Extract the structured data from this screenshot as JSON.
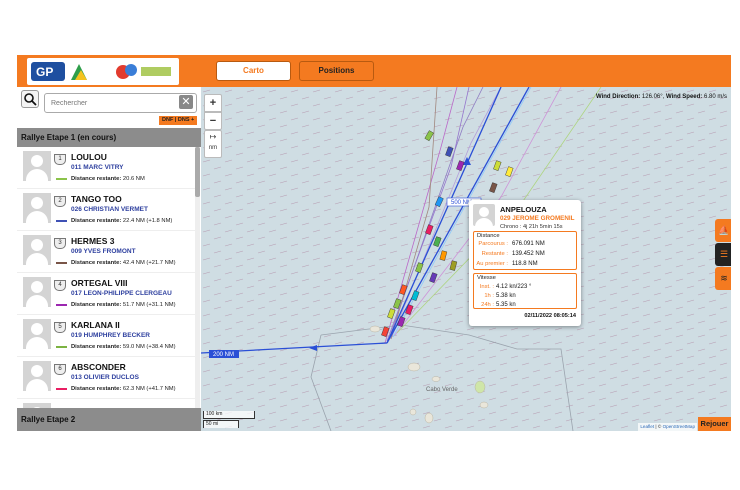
{
  "header": {
    "logo_text": "GP",
    "tabs": [
      {
        "label": "Carto"
      },
      {
        "label": "Positions"
      }
    ]
  },
  "sidebar": {
    "search_placeholder": "Rechercher",
    "clear_symbol": "✕",
    "filter_tag": "DNF | DNS +",
    "rally_current": "Rallye Etape 1 (en cours)",
    "rally_next": "Rallye Etape 2",
    "boats": [
      {
        "rank": "1",
        "name": "LOULOU",
        "skipper": "011 MARC VITRY",
        "distance_label": "Distance restante:",
        "distance_value": "20.6 NM",
        "color": "#8bc34a"
      },
      {
        "rank": "2",
        "name": "TANGO TOO",
        "skipper": "026 CHRISTIAN VERMET",
        "distance_label": "Distance restante:",
        "distance_value": "22.4 NM (+1.8 NM)",
        "color": "#3f51b5"
      },
      {
        "rank": "3",
        "name": "HERMES 3",
        "skipper": "009 YVES FROMONT",
        "distance_label": "Distance restante:",
        "distance_value": "42.4 NM (+21.7 NM)",
        "color": "#795548"
      },
      {
        "rank": "4",
        "name": "ORTEGAL VIII",
        "skipper": "017 LEON-PHILIPPE CLERGEAU",
        "distance_label": "Distance restante:",
        "distance_value": "51.7 NM (+31.1 NM)",
        "color": "#9c27b0"
      },
      {
        "rank": "5",
        "name": "KARLANA II",
        "skipper": "019 HUMPHREY BECKER",
        "distance_label": "Distance restante:",
        "distance_value": "59.0 NM (+38.4 NM)",
        "color": "#7cb342"
      },
      {
        "rank": "6",
        "name": "ABSCONDER",
        "skipper": "013 OLIVIER DUCLOS",
        "distance_label": "Distance restante:",
        "distance_value": "62.3 NM (+41.7 NM)",
        "color": "#e91e63"
      }
    ]
  },
  "map": {
    "wind_direction_label": "Wind Direction:",
    "wind_direction_value": "126.06°",
    "wind_speed_label": "Wind Speed:",
    "wind_speed_value": "6.80 m/s",
    "zoom_in": "+",
    "zoom_out": "−",
    "measure_unit": "nm",
    "line_label_top": "500 NM",
    "line_label_left": "200 NM",
    "island_label": "Cabo Verde",
    "scale_km": "100 km",
    "scale_mi": "50 mi",
    "attribution_leaflet": "Leaflet",
    "attribution_osm": "OpenStreetMap",
    "replay_button": "Rejouer"
  },
  "popup": {
    "boat_name": "ANPELOUZA",
    "skipper": "029 JEROME GROMENIL",
    "chrono": "Chrono : 4j 21h 5min 15s",
    "distance_title": "Distance",
    "parcourus_label": "Parcourus :",
    "parcourus_value": "676.091 NM",
    "restante_label": "Restante :",
    "restante_value": "139.452 NM",
    "premier_label": "Au premier :",
    "premier_value": "118.8 NM",
    "speed_title": "Vitesse",
    "inst_label": "Inst. :",
    "inst_value": "4.12 kn/223 °",
    "h1_label": "1h :",
    "h1_value": "5.38 kn",
    "h24_label": "24h :",
    "h24_value": "5.35 kn",
    "date": "02/11/2022 08:05:14"
  },
  "colors": {
    "accent": "#f47a20",
    "skipper_blue": "#2c3e9e",
    "route_blue": "#2a4fd6"
  }
}
